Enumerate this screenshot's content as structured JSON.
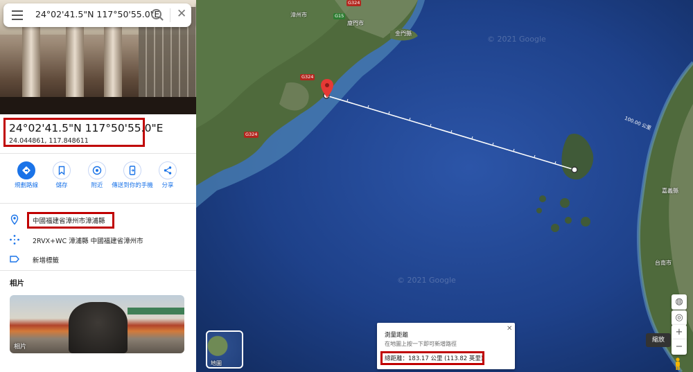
{
  "search": {
    "query": "24°02'41.5\"N 117°50'55.0\"E"
  },
  "place": {
    "title": "24°02'41.5\"N 117°50'55.0\"E",
    "decimal": "24.044861, 117.848611"
  },
  "actions": [
    {
      "label": "規劃路線",
      "icon": "directions-icon"
    },
    {
      "label": "儲存",
      "icon": "bookmark-icon"
    },
    {
      "label": "附近",
      "icon": "nearby-icon"
    },
    {
      "label": "傳送到你的手機",
      "icon": "send-to-phone-icon"
    },
    {
      "label": "分享",
      "icon": "share-icon"
    }
  ],
  "info": {
    "address": "中國福建省漳州市漳浦縣",
    "plus_code": "2RVX+WC 漳浦縣 中國福建省漳州市",
    "add_label": "新增標籤"
  },
  "photos": {
    "heading": "相片",
    "caption": "相片"
  },
  "map": {
    "towns": [
      "漳州市",
      "廈門市",
      "金門縣",
      "嘉義縣",
      "台南市"
    ],
    "roads": [
      "G324",
      "G15",
      "G324",
      "G324"
    ],
    "watermark": "© 2021 Google",
    "distance_marker": "100.00 公里",
    "layer_label": "地圖",
    "zoom_tooltip": "縮放",
    "colors": {
      "marker": "#e53935",
      "highlight": "#c00000",
      "accent": "#1a73e8"
    }
  },
  "measure": {
    "title": "測量距離",
    "hint": "在地圖上按一下即可新增路徑",
    "total": "總距離：183.17 公里 (113.82 英里)"
  }
}
